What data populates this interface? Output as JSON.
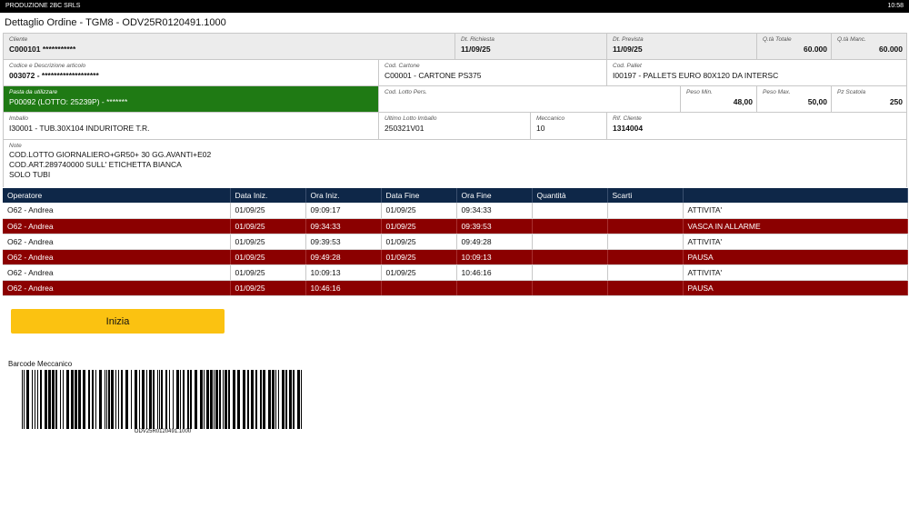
{
  "titlebar": {
    "app": "PRODUZIONE 2BC SRLS",
    "time": "10:58"
  },
  "page_title": "Dettaglio Ordine - TGM8 - ODV25R0120491.1000",
  "info": {
    "cliente": {
      "label": "Cliente",
      "value": "C000101 ***********"
    },
    "dt_richiesta": {
      "label": "Dt. Richiesta",
      "value": "11/09/25"
    },
    "dt_prevista": {
      "label": "Dt. Prevista",
      "value": "11/09/25"
    },
    "qta_totale": {
      "label": "Q.tà Totale",
      "value": "60.000"
    },
    "qta_manc": {
      "label": "Q.tà Manc.",
      "value": "60.000"
    },
    "articolo": {
      "label": "Codice e Descrizione articolo",
      "value": "003072 - *******************"
    },
    "cartone": {
      "label": "Cod. Cartone",
      "value": "C00001 - CARTONE PS375"
    },
    "pallet": {
      "label": "Cod. Pallet",
      "value": "I00197 - PALLETS EURO 80X120 DA INTERSC"
    },
    "pasta": {
      "label": "Pasta da utilizzare",
      "value": "P00092 (LOTTO: 25239P) - *******"
    },
    "lotto_pers": {
      "label": "Cod. Lotto Pers.",
      "value": ""
    },
    "peso_min": {
      "label": "Peso Min.",
      "value": "48,00"
    },
    "peso_max": {
      "label": "Peso Max.",
      "value": "50,00"
    },
    "pz_scatola": {
      "label": "Pz Scatola",
      "value": "250"
    },
    "imballo": {
      "label": "Imballo",
      "value": "I30001 - TUB.30X104 INDURITORE T.R."
    },
    "ultimo_lotto": {
      "label": "Ultimo Lotto Imballo",
      "value": "250321V01"
    },
    "meccanico": {
      "label": "Meccanico",
      "value": "10"
    },
    "rif_cliente": {
      "label": "Rif. Cliente",
      "value": "1314004"
    },
    "note": {
      "label": "Note",
      "lines": [
        "COD.LOTTO GIORNALIERO+GR50+ 30 GG.AVANTI+E02",
        "COD.ART.289740000 SULL' ETICHETTA BIANCA",
        "SOLO TUBI"
      ]
    }
  },
  "table": {
    "headers": [
      "Operatore",
      "Data Iniz.",
      "Ora Iniz.",
      "Data Fine",
      "Ora Fine",
      "Quantità",
      "Scarti",
      ""
    ],
    "rows": [
      {
        "alarm": false,
        "cells": [
          "O62 - Andrea",
          "01/09/25",
          "09:09:17",
          "01/09/25",
          "09:34:33",
          "",
          "",
          "ATTIVITA'"
        ]
      },
      {
        "alarm": true,
        "cells": [
          "O62 - Andrea",
          "01/09/25",
          "09:34:33",
          "01/09/25",
          "09:39:53",
          "",
          "",
          "VASCA IN ALLARME"
        ]
      },
      {
        "alarm": false,
        "cells": [
          "O62 - Andrea",
          "01/09/25",
          "09:39:53",
          "01/09/25",
          "09:49:28",
          "",
          "",
          "ATTIVITA'"
        ]
      },
      {
        "alarm": true,
        "cells": [
          "O62 - Andrea",
          "01/09/25",
          "09:49:28",
          "01/09/25",
          "10:09:13",
          "",
          "",
          "PAUSA"
        ]
      },
      {
        "alarm": false,
        "cells": [
          "O62 - Andrea",
          "01/09/25",
          "10:09:13",
          "01/09/25",
          "10:46:16",
          "",
          "",
          "ATTIVITA'"
        ]
      },
      {
        "alarm": true,
        "cells": [
          "O62 - Andrea",
          "01/09/25",
          "10:46:16",
          "",
          "",
          "",
          "",
          "PAUSA"
        ]
      }
    ]
  },
  "actions": {
    "start_label": "Inizia"
  },
  "barcode": {
    "label": "Barcode Meccanico",
    "text": "ODV25R0120491.1000"
  },
  "colors": {
    "header": "#0e2748",
    "alarm": "#8b0000",
    "pasta": "#1f7a14",
    "button": "#fbc211"
  }
}
